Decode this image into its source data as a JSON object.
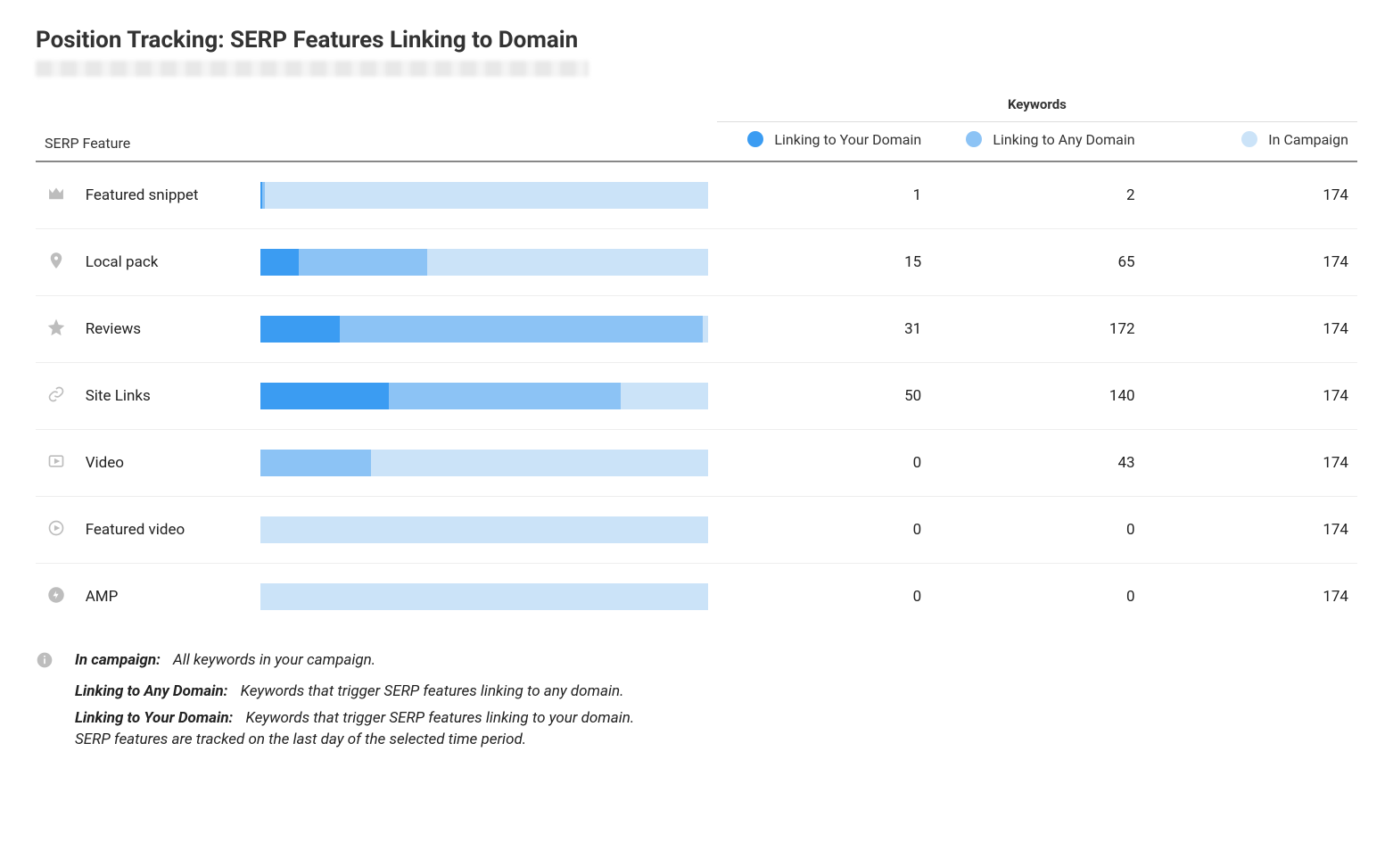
{
  "title": "Position Tracking: SERP Features Linking to Domain",
  "headers": {
    "serp_feature": "SERP Feature",
    "keywords": "Keywords",
    "linking_your": "Linking to Your Domain",
    "linking_any": "Linking to Any Domain",
    "in_campaign": "In Campaign"
  },
  "colors": {
    "your": "#3b9cf2",
    "any": "#8cc3f5",
    "campaign": "#cbe3f8"
  },
  "rows": [
    {
      "icon": "crown",
      "name": "Featured snippet",
      "your": 1,
      "any": 2,
      "campaign": 174
    },
    {
      "icon": "pin",
      "name": "Local pack",
      "your": 15,
      "any": 65,
      "campaign": 174
    },
    {
      "icon": "star",
      "name": "Reviews",
      "your": 31,
      "any": 172,
      "campaign": 174
    },
    {
      "icon": "link",
      "name": "Site Links",
      "your": 50,
      "any": 140,
      "campaign": 174
    },
    {
      "icon": "play-sq",
      "name": "Video",
      "your": 0,
      "any": 43,
      "campaign": 174
    },
    {
      "icon": "play-ci",
      "name": "Featured video",
      "your": 0,
      "any": 0,
      "campaign": 174
    },
    {
      "icon": "bolt",
      "name": "AMP",
      "your": 0,
      "any": 0,
      "campaign": 174
    }
  ],
  "definitions": {
    "in_campaign": {
      "term": "In campaign:",
      "desc": "All keywords in your campaign."
    },
    "linking_any": {
      "term": "Linking to Any Domain:",
      "desc": "Keywords that trigger SERP features linking to any domain."
    },
    "linking_your": {
      "term": "Linking to Your Domain:",
      "desc": "Keywords that trigger SERP features linking to your domain."
    },
    "footnote": "SERP features are tracked on the last day of the selected time period."
  },
  "chart_data": {
    "type": "bar",
    "orientation": "horizontal",
    "stacked_overlay": true,
    "categories": [
      "Featured snippet",
      "Local pack",
      "Reviews",
      "Site Links",
      "Video",
      "Featured video",
      "AMP"
    ],
    "series": [
      {
        "name": "Linking to Your Domain",
        "color": "#3b9cf2",
        "values": [
          1,
          15,
          31,
          50,
          0,
          0,
          0
        ]
      },
      {
        "name": "Linking to Any Domain",
        "color": "#8cc3f5",
        "values": [
          2,
          65,
          172,
          140,
          43,
          0,
          0
        ]
      },
      {
        "name": "In Campaign",
        "color": "#cbe3f8",
        "values": [
          174,
          174,
          174,
          174,
          174,
          174,
          174
        ]
      }
    ],
    "xlim": [
      0,
      174
    ],
    "title": "Position Tracking: SERP Features Linking to Domain",
    "xlabel": "Keywords",
    "ylabel": "SERP Feature"
  }
}
